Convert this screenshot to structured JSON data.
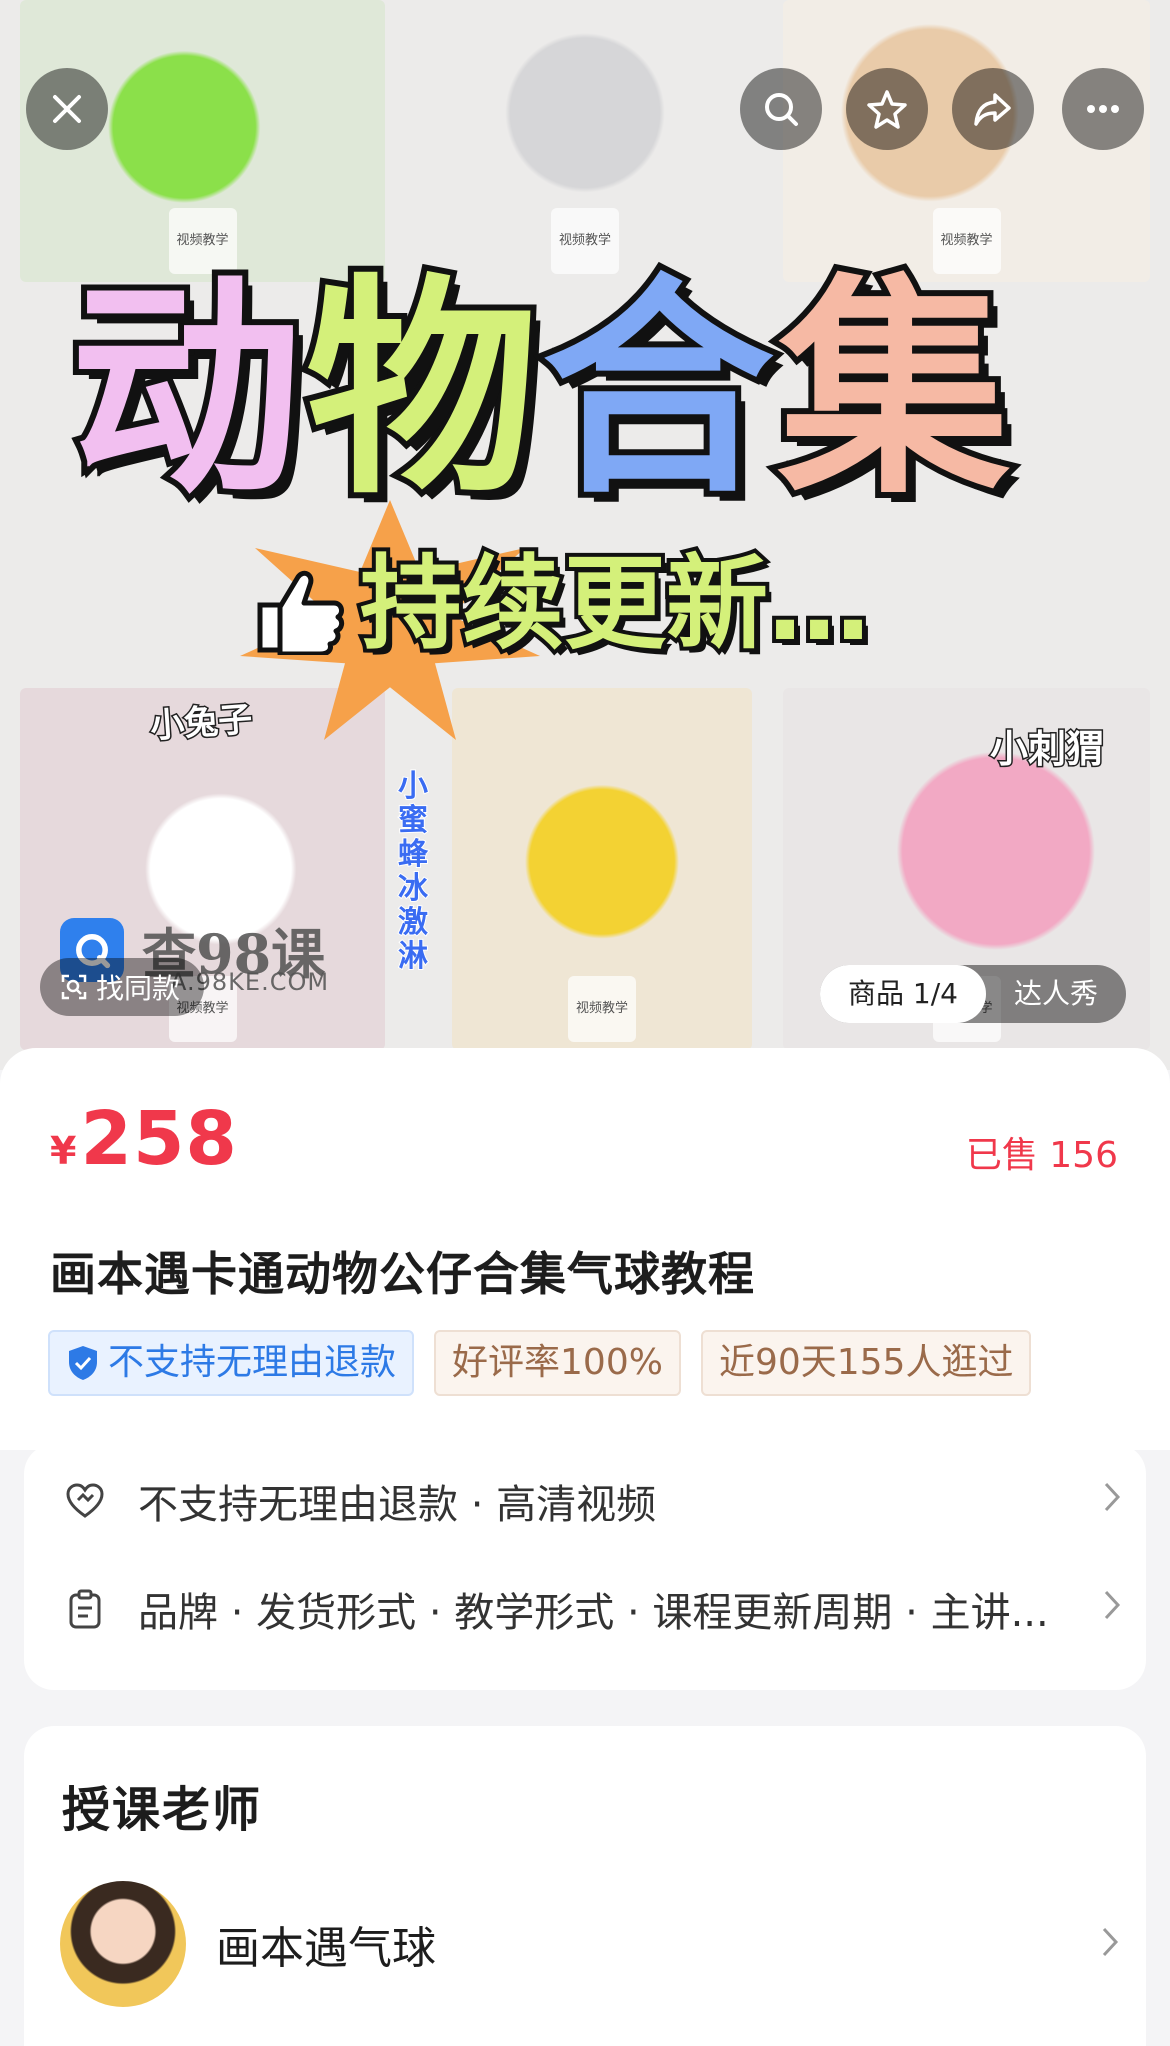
{
  "banner": {
    "headline": [
      "动",
      "物",
      "合",
      "集"
    ],
    "headline_colors": [
      "#f2bff0",
      "#d4f07a",
      "#7fa8f5",
      "#f6b9a4"
    ],
    "subline": "持续更新…",
    "tile_tag": "视频教学",
    "tile_labels": {
      "rabbit": "小兔子",
      "bee": "小蜜蜂冰激淋",
      "hedgehog": "小刺猬"
    },
    "watermark": {
      "brand": "查98课",
      "url": "A.98KE.COM"
    },
    "find_same": "找同款",
    "pager": {
      "products": "商品 1/4",
      "showcase": "达人秀"
    },
    "top_buttons": [
      "close-icon",
      "search-icon",
      "star-icon",
      "share-icon",
      "more-icon"
    ]
  },
  "product": {
    "currency": "¥",
    "price": "258",
    "sold": "已售 156",
    "title": "画本遇卡通动物公仔合集气球教程",
    "tags": [
      {
        "label": "不支持无理由退款",
        "style": "blue",
        "icon": "shield-check-icon"
      },
      {
        "label": "好评率100%",
        "style": "brown"
      },
      {
        "label": "近90天155人逛过",
        "style": "brown"
      }
    ]
  },
  "info": {
    "row1": {
      "icon": "heart-icon",
      "text": "不支持无理由退款 · 高清视频"
    },
    "row2": {
      "icon": "clipboard-icon",
      "text": "品牌 · 发货形式 · 教学形式 · 课程更新周期 · 主讲..."
    }
  },
  "teacher": {
    "heading": "授课老师",
    "name": "画本遇气球"
  },
  "colors": {
    "accent_red": "#f0384b",
    "tag_blue": "#2d7ae6",
    "tag_brown": "#9a6a4a"
  }
}
